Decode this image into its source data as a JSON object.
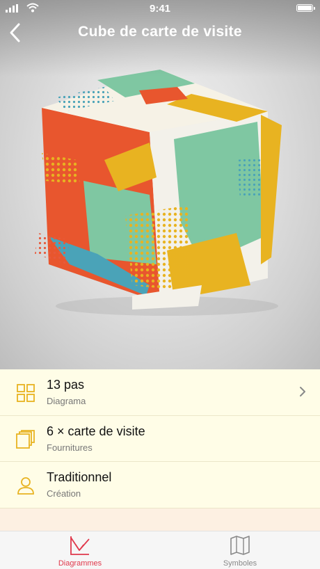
{
  "status_bar": {
    "time": "9:41"
  },
  "nav": {
    "title": "Cube de carte de visite"
  },
  "hero": {
    "image": "business-card-cube-photo"
  },
  "details": [
    {
      "title": "13 pas",
      "subtitle": "Diagrama",
      "icon": "grid-icon",
      "has_chevron": true
    },
    {
      "title": "6 × carte de visite",
      "subtitle": "Fournitures",
      "icon": "cards-stack-icon",
      "has_chevron": false
    },
    {
      "title": "Traditionnel",
      "subtitle": "Création",
      "icon": "person-icon",
      "has_chevron": false
    }
  ],
  "tabs": [
    {
      "label": "Diagrammes",
      "icon": "diagram-fold-icon",
      "active": true
    },
    {
      "label": "Symboles",
      "icon": "map-book-icon",
      "active": false
    }
  ],
  "colors": {
    "accent": "#e0384b",
    "icon_yellow": "#e8b321",
    "list_bg": "#fffde7"
  }
}
